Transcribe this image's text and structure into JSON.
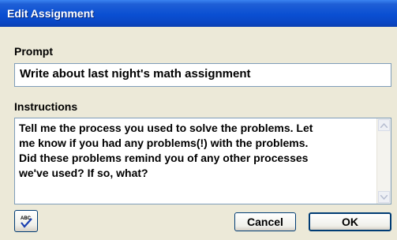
{
  "window": {
    "title": "Edit Assignment"
  },
  "prompt": {
    "label": "Prompt",
    "value": "Write about last night's math assignment"
  },
  "instructions": {
    "label": "Instructions",
    "value": "Tell me the process you used to solve the problems. Let\nme know if you had any problems(!) with the problems.\nDid these problems remind you of any other processes\nwe've used? If so, what?"
  },
  "buttons": {
    "spellcheck_icon": "spellcheck-icon",
    "spellcheck_text": "ABC",
    "cancel": "Cancel",
    "ok": "OK"
  },
  "colors": {
    "titlebar": "#0a4fd2",
    "dialog_bg": "#ece9d8",
    "field_border": "#7f9db9",
    "button_border": "#003c74"
  }
}
